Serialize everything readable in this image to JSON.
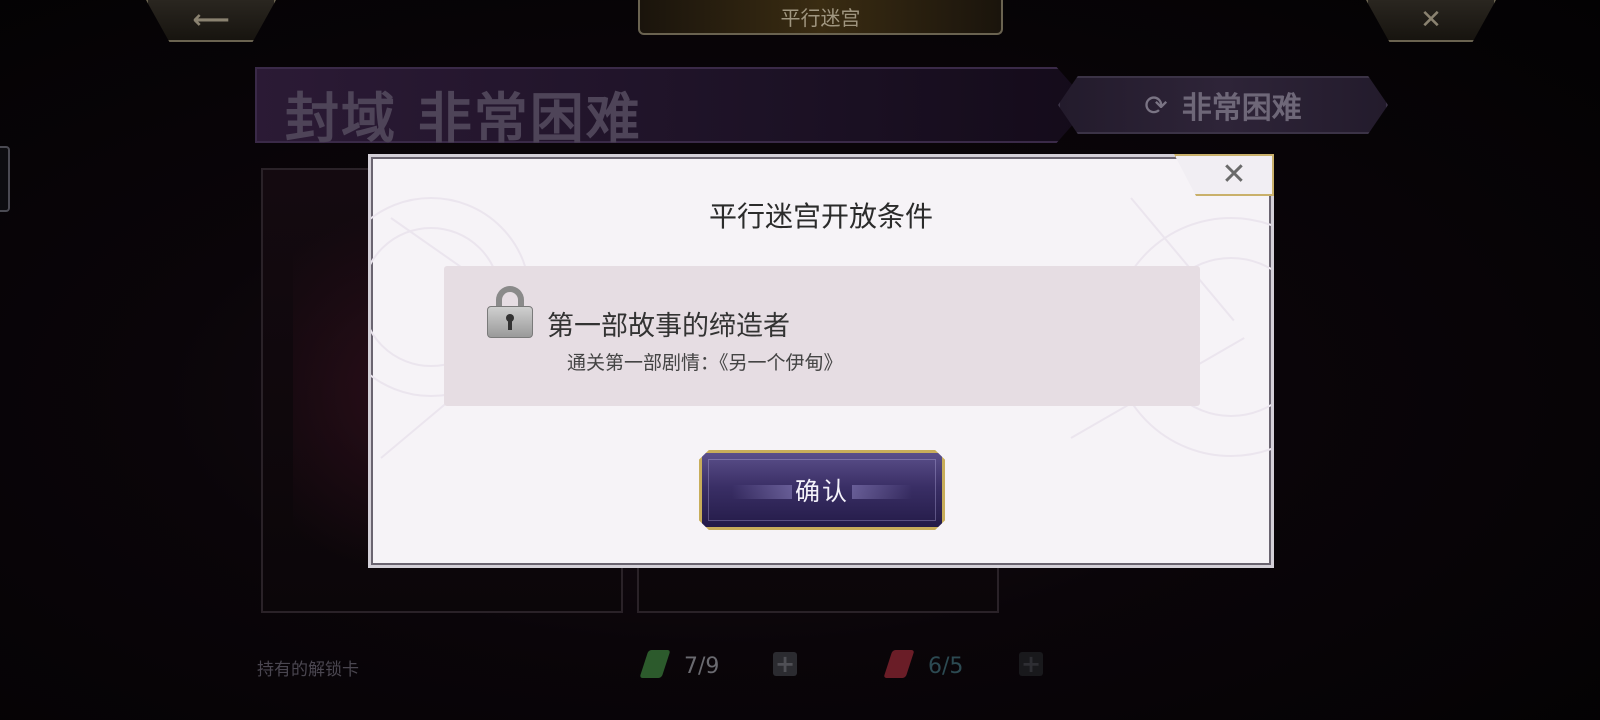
{
  "header": {
    "back_icon": "back-arrow-icon",
    "title": "平行迷宫",
    "close_icon": "close-icon"
  },
  "banner": {
    "title": "封域 非常困难"
  },
  "difficulty_button": {
    "icon": "refresh-icon",
    "label": "非常困难"
  },
  "footer": {
    "unlock_label": "持有的解锁卡",
    "green_card_count": "7/9",
    "red_card_count": "6/5"
  },
  "modal": {
    "title": "平行迷宫开放条件",
    "condition": {
      "icon": "lock-icon",
      "title": "第一部故事的缔造者",
      "description": "通关第一部剧情：《另一个伊甸》"
    },
    "confirm_label": "确认",
    "close_icon": "close-icon"
  },
  "colors": {
    "modal_bg": "#f6f3f7",
    "condition_bg": "#e6dde3",
    "button_purple": "#3a2f66",
    "gold_border": "#c8ad5a"
  }
}
